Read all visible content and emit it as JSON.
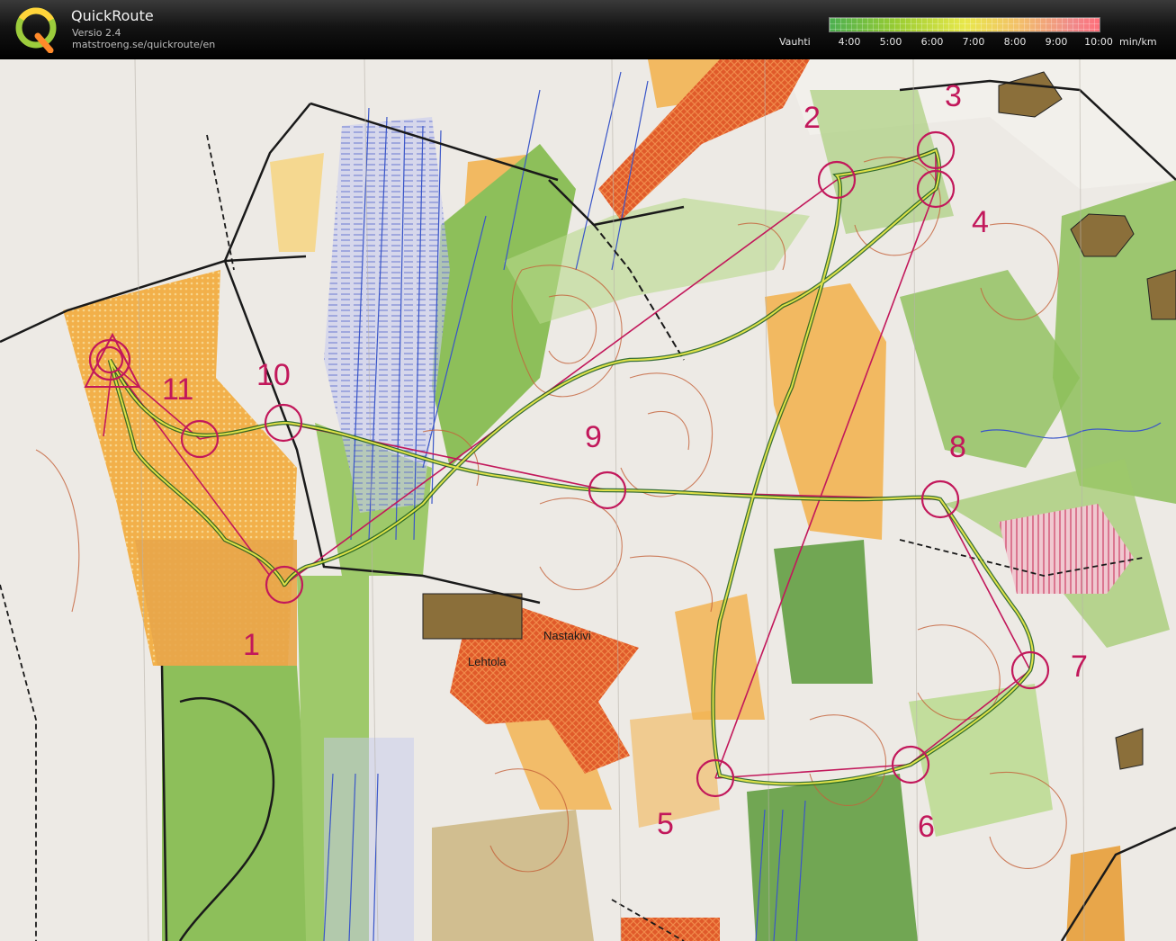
{
  "app": {
    "title": "QuickRoute",
    "version": "Versio 2.4",
    "url": "matstroeng.se/quickroute/en",
    "logo_icon": "quickroute-q-logo"
  },
  "pace_legend": {
    "label": "Vauhti",
    "ticks": [
      "4:00",
      "5:00",
      "6:00",
      "7:00",
      "8:00",
      "9:00",
      "10:00"
    ],
    "unit": "min/km",
    "colors": [
      "#4caf50",
      "#9acd32",
      "#e8e84a",
      "#f3c06a",
      "#f08a8a",
      "#ff6f7a"
    ]
  },
  "map": {
    "place_names": [
      "Nastakivi",
      "Lehtola"
    ],
    "control_labels": [
      "1",
      "2",
      "3",
      "4",
      "5",
      "6",
      "7",
      "8",
      "9",
      "10",
      "11"
    ],
    "colors": {
      "course": "#c2185b",
      "route": "#e8e84a",
      "open_land": "#f2b04a",
      "rough_open": "#f5d890",
      "forest_slow": "#8dbf5a",
      "forest_dense": "#5a9a3a",
      "marsh": "#5566cc",
      "settlement": "#e05a2a",
      "building": "#8b6f3a",
      "paper": "#f4f2ee"
    }
  }
}
